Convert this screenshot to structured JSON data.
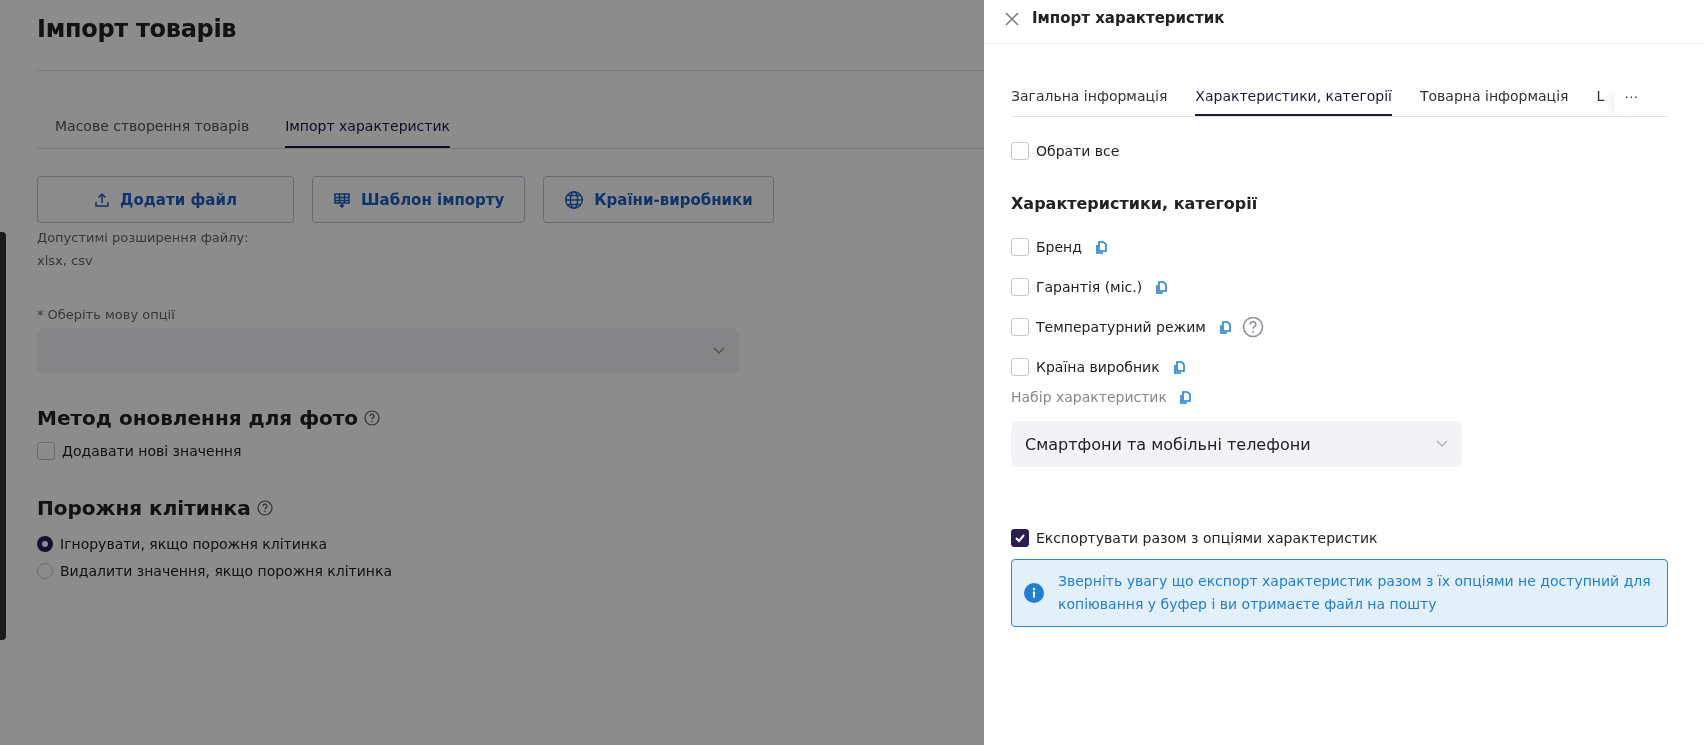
{
  "page": {
    "title": "Імпорт товарів",
    "tabs": [
      {
        "label": "Масове створення товарів",
        "selected": false
      },
      {
        "label": "Імпорт характеристик",
        "selected": true
      }
    ],
    "buttons": [
      {
        "label": "Додати файл",
        "kind": "upload"
      },
      {
        "label": "Шаблон імпорту",
        "kind": "template"
      },
      {
        "label": "Країни-виробники",
        "kind": "globe"
      }
    ],
    "file_hint": [
      "Допустимі розширення файлу:",
      "xlsx, csv"
    ],
    "language_select": {
      "required_mark": "*",
      "label": "Оберіть мову опції"
    },
    "photo_method": {
      "heading": "Метод оновлення для фото",
      "option": {
        "label": "Додавати нові значення",
        "checked": false
      }
    },
    "empty_cell": {
      "heading": "Порожня клітинка",
      "options": [
        {
          "label": "Ігнорувати, якщо порожня клітинка",
          "selected": true
        },
        {
          "label": "Видалити значення, якщо порожня клітинка",
          "selected": false
        }
      ]
    }
  },
  "drawer": {
    "title": "Імпорт характеристик",
    "tabs": [
      {
        "label": "Загальна інформація",
        "selected": false
      },
      {
        "label": "Характеристики, категорії",
        "selected": true
      },
      {
        "label": "Товарна інформація",
        "selected": false
      },
      {
        "label": "L",
        "selected": false
      }
    ],
    "more": "···",
    "select_all": {
      "label": "Обрати все",
      "checked": false
    },
    "section_heading": "Характеристики, категорії",
    "fields": [
      {
        "label": "Бренд",
        "checked": false,
        "kind": "plain"
      },
      {
        "label": "Гарантія (міс.)",
        "checked": false,
        "kind": "plain"
      },
      {
        "label": "Температурний режим",
        "checked": false,
        "kind": "help"
      },
      {
        "label": "Країна виробник",
        "checked": false,
        "kind": "plain"
      }
    ],
    "set_label": "Набір характеристик",
    "set_value": "Смартфони та мобільні телефони",
    "export_with_options": {
      "label": "Експортувати разом з опціями характеристик",
      "checked": true
    },
    "notice": "Зверніть увагу що експорт характеристик разом з їх опціями не доступний для копіювання у буфер і ви отримаєте файл на пошту"
  }
}
